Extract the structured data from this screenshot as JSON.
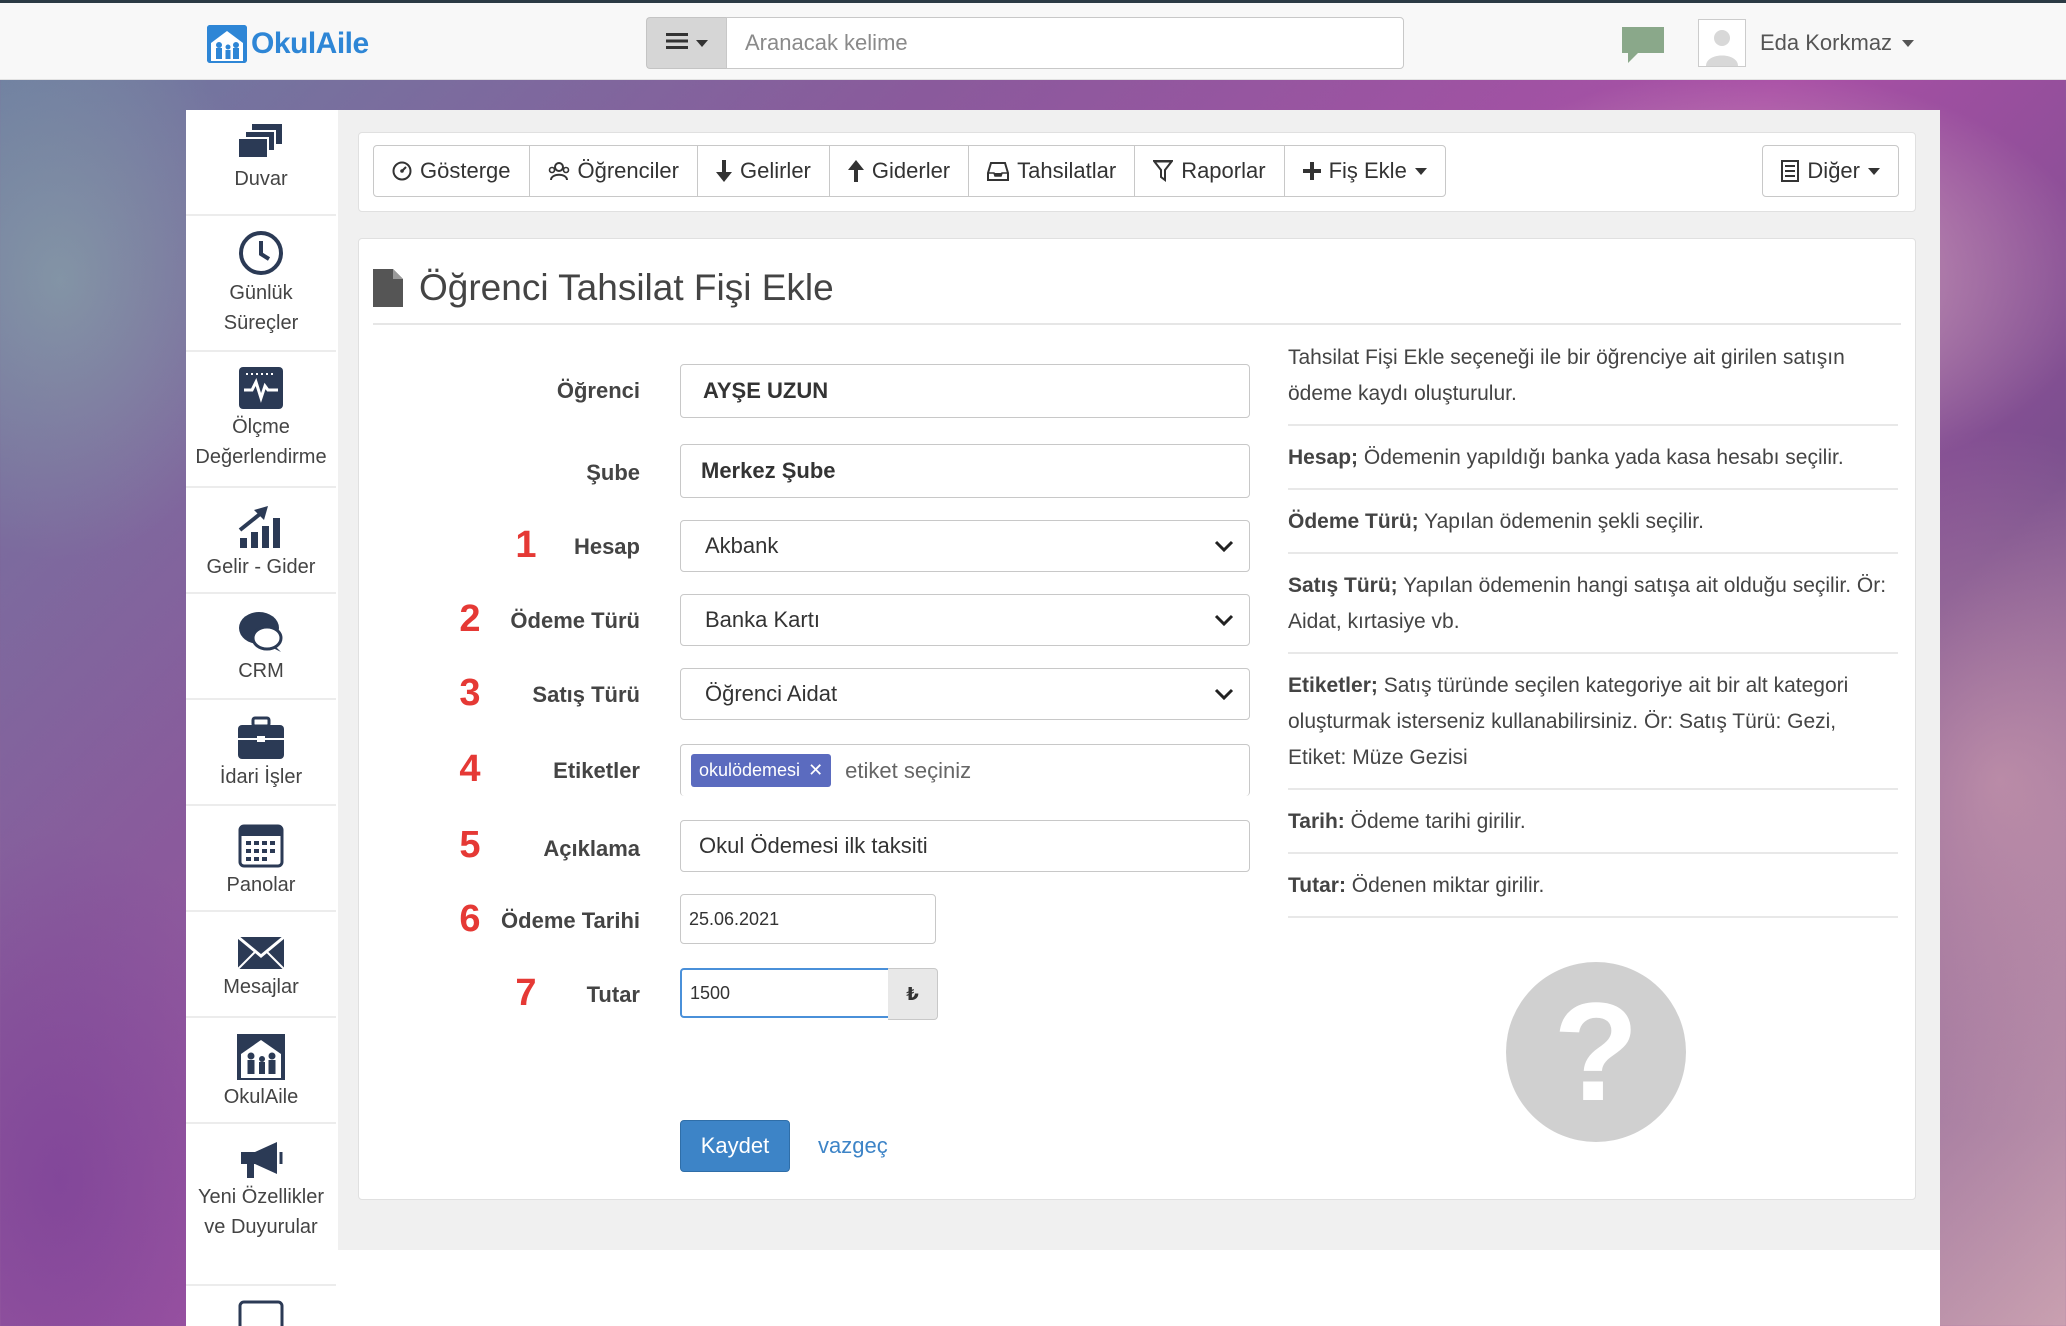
{
  "brand": {
    "name": "OkulAile",
    "color": "#2e86d6"
  },
  "search": {
    "placeholder": "Aranacak kelime"
  },
  "user": {
    "name": "Eda Korkmaz"
  },
  "sidebar": {
    "items": [
      {
        "label": "Duvar",
        "icon": "layers-icon"
      },
      {
        "label": "Günlük Süreçler",
        "icon": "clock-icon"
      },
      {
        "label": "Ölçme Değerlendirme",
        "icon": "monitor-icon"
      },
      {
        "label": "Gelir - Gider",
        "icon": "chart-up-icon"
      },
      {
        "label": "CRM",
        "icon": "chat-bubbles-icon"
      },
      {
        "label": "İdari İşler",
        "icon": "briefcase-icon"
      },
      {
        "label": "Panolar",
        "icon": "calendar-icon"
      },
      {
        "label": "Mesajlar",
        "icon": "envelope-icon"
      },
      {
        "label": "OkulAile",
        "icon": "okulaile-icon"
      },
      {
        "label": "Yeni Özellikler ve Duyurular",
        "icon": "megaphone-icon"
      }
    ]
  },
  "toolbar": {
    "buttons": [
      {
        "label": "Gösterge",
        "icon": "dashboard-icon"
      },
      {
        "label": "Öğrenciler",
        "icon": "students-icon"
      },
      {
        "label": "Gelirler",
        "icon": "arrow-down-icon"
      },
      {
        "label": "Giderler",
        "icon": "arrow-up-icon"
      },
      {
        "label": "Tahsilatlar",
        "icon": "inbox-icon"
      },
      {
        "label": "Raporlar",
        "icon": "filter-icon"
      },
      {
        "label": "Fiş Ekle",
        "icon": "plus-icon"
      }
    ],
    "other_label": "Diğer"
  },
  "form": {
    "title": "Öğrenci Tahsilat Fişi Ekle",
    "fields": {
      "ogrenci": {
        "label": "Öğrenci",
        "value": "AYŞE UZUN"
      },
      "sube": {
        "label": "Şube",
        "value": "Merkez Şube"
      },
      "hesap": {
        "num": "1",
        "label": "Hesap",
        "value": "Akbank"
      },
      "odeme_turu": {
        "num": "2",
        "label": "Ödeme Türü",
        "value": "Banka Kartı"
      },
      "satis_turu": {
        "num": "3",
        "label": "Satış Türü",
        "value": "Öğrenci Aidat"
      },
      "etiketler": {
        "num": "4",
        "label": "Etiketler",
        "tag": "okulödemesi",
        "placeholder": "etiket seçiniz"
      },
      "aciklama": {
        "num": "5",
        "label": "Açıklama",
        "value": "Okul Ödemesi ilk taksiti"
      },
      "odeme_tarihi": {
        "num": "6",
        "label": "Ödeme Tarihi",
        "value": "25.06.2021"
      },
      "tutar": {
        "num": "7",
        "label": "Tutar",
        "value": "1500",
        "currency": "₺"
      }
    },
    "save_label": "Kaydet",
    "cancel_label": "vazgeç"
  },
  "help": {
    "intro": "Tahsilat Fişi Ekle seçeneği ile bir öğrenciye ait girilen satışın ödeme kaydı oluşturulur.",
    "items": [
      {
        "term": "Hesap;",
        "text": " Ödemenin yapıldığı banka yada kasa hesabı seçilir."
      },
      {
        "term": "Ödeme Türü;",
        "text": " Yapılan ödemenin şekli seçilir."
      },
      {
        "term": "Satış Türü;",
        "text": " Yapılan ödemenin hangi satışa ait olduğu seçilir. Ör: Aidat, kırtasiye vb."
      },
      {
        "term": "Etiketler;",
        "text": " Satış türünde seçilen kategoriye ait bir alt kategori oluşturmak isterseniz kullanabilirsiniz. Ör: Satış Türü: Gezi, Etiket: Müze Gezisi"
      },
      {
        "term": "Tarih:",
        "text": " Ödeme tarihi girilir."
      },
      {
        "term": "Tutar:",
        "text": " Ödenen miktar girilir."
      }
    ]
  },
  "colors": {
    "accent": "#3d84c7",
    "annotation_red": "#e53935",
    "tag_chip": "#5b6bbf"
  }
}
